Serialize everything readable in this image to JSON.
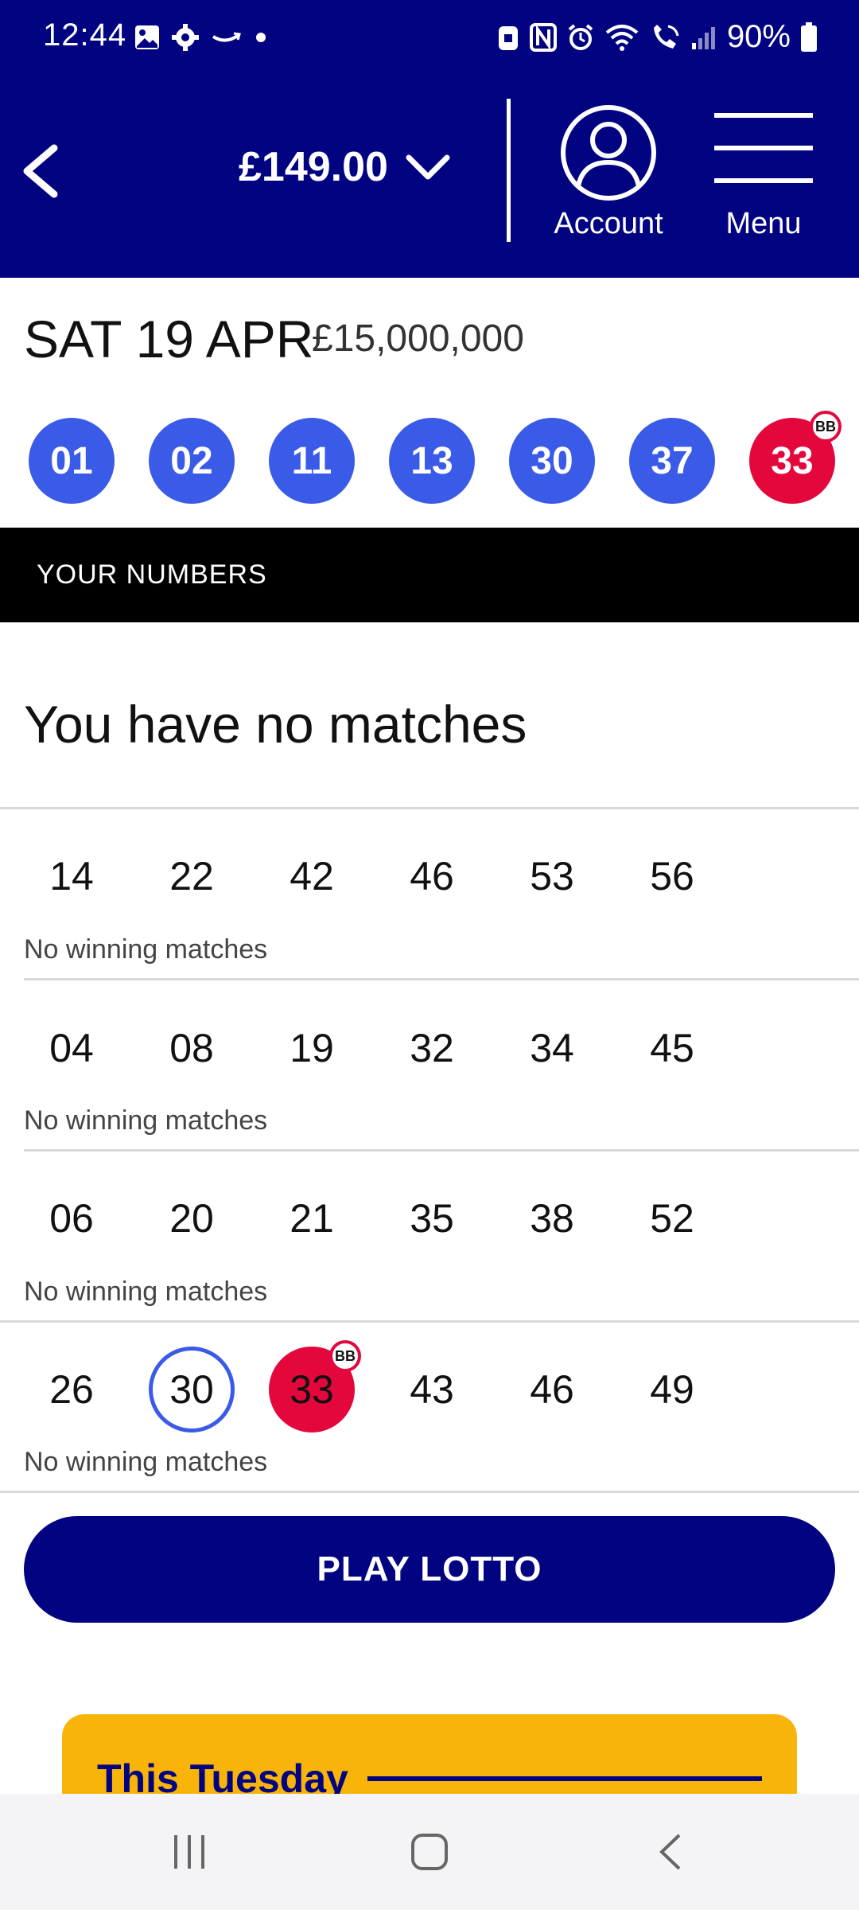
{
  "status_bar": {
    "time": "12:44",
    "battery": "90%"
  },
  "header": {
    "balance": "£149.00",
    "account_label": "Account",
    "menu_label": "Menu"
  },
  "draw": {
    "date": "SAT 19 APR",
    "jackpot": "£15,000,000",
    "balls": [
      "01",
      "02",
      "11",
      "13",
      "30",
      "37"
    ],
    "bonus_ball": "33",
    "bonus_badge": "BB"
  },
  "your_numbers": {
    "section_label": "YOUR NUMBERS",
    "summary": "You have no matches",
    "lines": [
      {
        "numbers": [
          "14",
          "22",
          "42",
          "46",
          "53",
          "56"
        ],
        "status": "No winning matches"
      },
      {
        "numbers": [
          "04",
          "08",
          "19",
          "32",
          "34",
          "45"
        ],
        "status": "No winning matches"
      },
      {
        "numbers": [
          "06",
          "20",
          "21",
          "35",
          "38",
          "52"
        ],
        "status": "No winning matches"
      },
      {
        "numbers": [
          "26",
          "30",
          "33",
          "43",
          "46",
          "49"
        ],
        "status": "No winning matches",
        "badge": "BB"
      }
    ]
  },
  "cta": {
    "play_label": "PLAY LOTTO"
  },
  "promo": {
    "title": "This Tuesday"
  },
  "colors": {
    "navy": "#020381",
    "ball_blue": "#3a5ae8",
    "bonus_red": "#e3073c",
    "promo_yellow": "#f8b408"
  }
}
